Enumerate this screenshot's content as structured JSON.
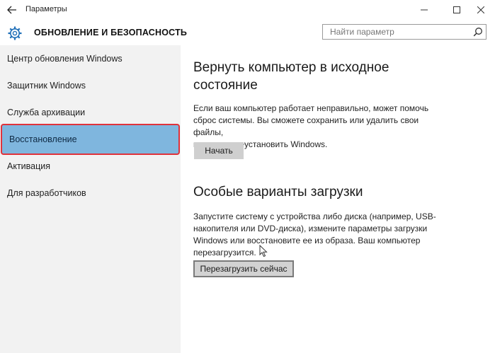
{
  "titlebar": {
    "app_title": "Параметры",
    "back_icon": "arrow-left-icon",
    "minimize_icon": "minimize-icon",
    "maximize_icon": "maximize-icon",
    "close_icon": "close-icon"
  },
  "header": {
    "icon": "gear-icon",
    "title": "ОБНОВЛЕНИЕ И БЕЗОПАСНОСТЬ"
  },
  "search": {
    "placeholder": "Найти параметр",
    "icon": "search-icon"
  },
  "sidebar": {
    "items": [
      {
        "label": "Центр обновления Windows",
        "selected": false
      },
      {
        "label": "Защитник Windows",
        "selected": false
      },
      {
        "label": "Служба архивации",
        "selected": false
      },
      {
        "label": "Восстановление",
        "selected": true
      },
      {
        "label": "Активация",
        "selected": false
      },
      {
        "label": "Для разработчиков",
        "selected": false
      }
    ]
  },
  "main": {
    "reset": {
      "title_line1": "Вернуть компьютер в исходное",
      "title_line2": "состояние",
      "desc_line1": "Если ваш компьютер работает неправильно, может помочь",
      "desc_line2": "сброс системы. Вы сможете сохранить или удалить свои файлы,",
      "desc_line3": "и затем переустановить Windows.",
      "button": "Начать"
    },
    "advanced": {
      "title": "Особые варианты загрузки",
      "desc_line1": "Запустите систему с устройства либо диска (например, USB-",
      "desc_line2": "накопителя или DVD-диска), измените параметры загрузки",
      "desc_line3": "Windows или восстановите ее из образа. Ваш компьютер",
      "desc_line4": "перезагрузится.",
      "button": "Перезагрузить сейчас"
    }
  },
  "colors": {
    "selected_bg": "#7fb6de",
    "highlight_border": "#e0323b",
    "sidebar_bg": "#f2f2f2",
    "button_bg": "#cfcfcf"
  }
}
